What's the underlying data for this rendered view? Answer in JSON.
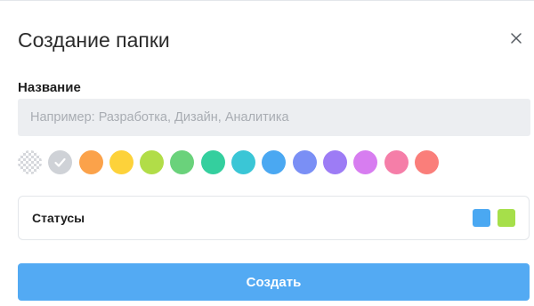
{
  "dialog": {
    "title": "Создание папки",
    "close_icon": "close-icon"
  },
  "name_field": {
    "label": "Название",
    "value": "",
    "placeholder": "Например: Разработка, Дизайн, Аналитика"
  },
  "color_picker": {
    "selected": "gray",
    "options": [
      {
        "id": "transparent",
        "color": "transparent"
      },
      {
        "id": "gray",
        "color": "#cfd2d7",
        "selected": true,
        "icon": "check-icon"
      },
      {
        "id": "orange",
        "color": "#fba24a"
      },
      {
        "id": "yellow",
        "color": "#fdd23a"
      },
      {
        "id": "lime",
        "color": "#b1dd48"
      },
      {
        "id": "green",
        "color": "#6ad27b"
      },
      {
        "id": "teal",
        "color": "#34cf9e"
      },
      {
        "id": "cyan",
        "color": "#3ac6d6"
      },
      {
        "id": "blue",
        "color": "#4aa8f2"
      },
      {
        "id": "indigo",
        "color": "#7a8ff5"
      },
      {
        "id": "purple",
        "color": "#9d7cf5"
      },
      {
        "id": "violet",
        "color": "#d77df0"
      },
      {
        "id": "pink",
        "color": "#f57ea8"
      },
      {
        "id": "red",
        "color": "#fa7e7a"
      }
    ]
  },
  "statuses": {
    "label": "Статусы",
    "colors": [
      "#4aa8f2",
      "#a6df4a"
    ]
  },
  "submit": {
    "label": "Создать",
    "color": "#53aaf3"
  }
}
